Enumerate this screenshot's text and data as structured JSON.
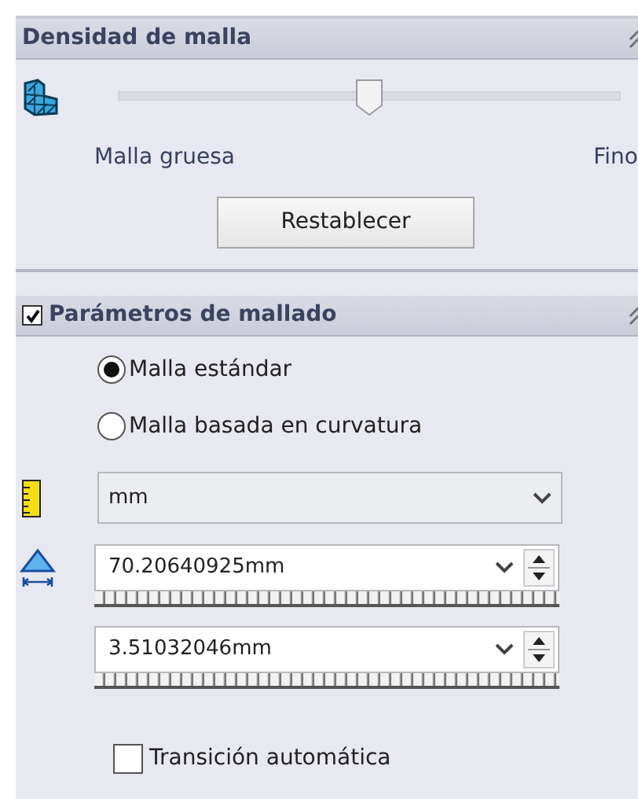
{
  "mesh_density": {
    "title": "Densidad de malla",
    "slider": {
      "level": 0.5
    },
    "min_label": "Malla gruesa",
    "max_label": "Fino",
    "reset_button": "Restablecer"
  },
  "mesh_parameters": {
    "title": "Parámetros de mallado",
    "checked": true,
    "options": [
      {
        "label": "Malla estándar",
        "selected": true
      },
      {
        "label": "Malla basada en curvatura",
        "selected": false
      }
    ],
    "units": {
      "value": "mm"
    },
    "fields": [
      {
        "value": "70.20640925mm"
      },
      {
        "value": "3.51032046mm"
      }
    ],
    "auto_transition": {
      "label": "Transición automática",
      "checked": false
    }
  }
}
